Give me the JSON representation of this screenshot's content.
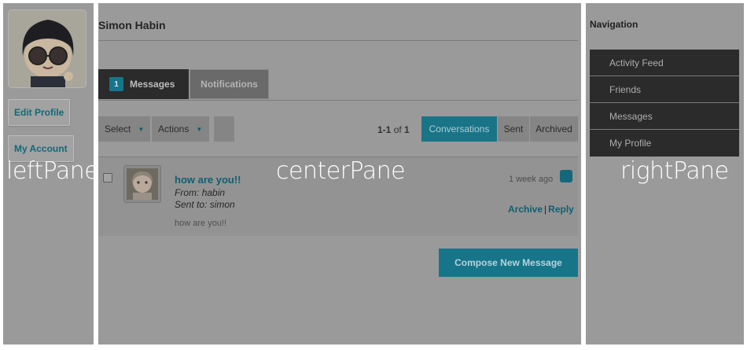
{
  "left_pane": {
    "label": "leftPane",
    "edit_profile": "Edit Profile",
    "my_account": "My Account"
  },
  "center_pane": {
    "label": "centerPane",
    "user_name": "Simon Habin",
    "tabs": {
      "messages": {
        "badge": "1",
        "label": "Messages"
      },
      "notifications": {
        "label": "Notifications"
      }
    },
    "toolbar": {
      "select": "Select",
      "actions": "Actions",
      "count_range": "1-1",
      "count_of": "of",
      "count_total": "1"
    },
    "filters": [
      "Conversations",
      "Sent",
      "Archived"
    ],
    "message": {
      "subject": "how are you!!",
      "from_label": "From:",
      "from": "habin",
      "to_label": "Sent to:",
      "to": "simon",
      "body": "how are you!!",
      "time": "1 week ago",
      "archive": "Archive",
      "separator": "|",
      "reply": "Reply"
    },
    "compose": "Compose New Message"
  },
  "right_pane": {
    "label": "rightPane",
    "nav_title": "Navigation",
    "nav_items": [
      "Activity Feed",
      "Friends",
      "Messages",
      "My Profile"
    ]
  },
  "colors": {
    "pane_bg": "#9a9a9a",
    "accent": "#17758a",
    "nav_dark": "#2b2b2b"
  }
}
